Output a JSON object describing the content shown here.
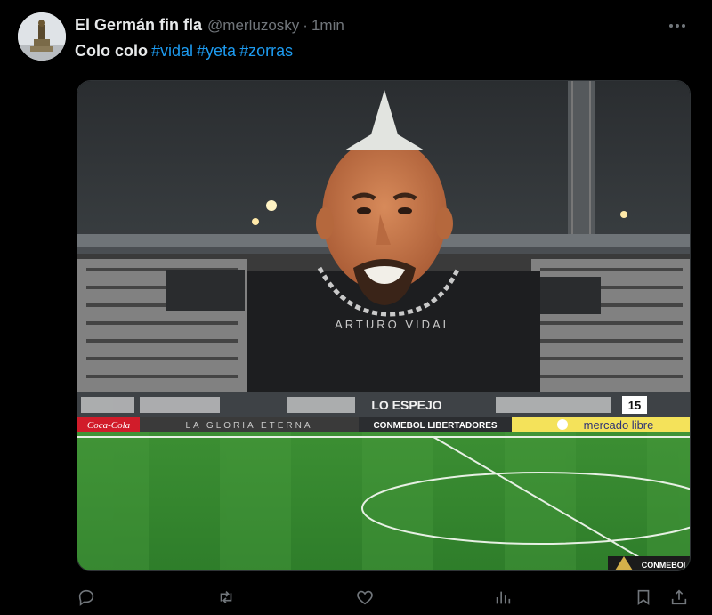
{
  "tweet": {
    "display_name": "El Germán fin fla",
    "handle": "@merluzosky",
    "separator": "·",
    "time": "1min",
    "text": "Colo colo",
    "hashtags": [
      "#vidal",
      "#yeta",
      "#zorras"
    ]
  },
  "media": {
    "banner_text": "ARTURO VIDAL",
    "ad_cocacola": "Coca-Cola",
    "ad_gloria": "LA GLORIA ETERNA",
    "ad_conmebol": "CONMEBOL LIBERTADORES",
    "ad_mercado": "mercado libre",
    "stand_banner": "LO ESPEJO",
    "stand_number": "15",
    "corner_logo": "CONMEBOL"
  },
  "actions": {
    "reply_icon": "reply-icon",
    "retweet_icon": "retweet-icon",
    "like_icon": "heart-icon",
    "views_icon": "views-icon",
    "bookmark_icon": "bookmark-icon",
    "share_icon": "share-icon"
  },
  "colors": {
    "background": "#000000",
    "text": "#e7e9ea",
    "muted": "#71767b",
    "link": "#1d9bf0",
    "pitch": "#2f8a2c"
  }
}
